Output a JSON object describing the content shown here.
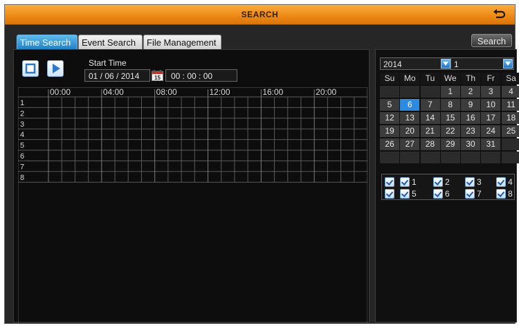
{
  "window": {
    "title": "SEARCH"
  },
  "tabs": [
    {
      "label": "Time Search",
      "active": true
    },
    {
      "label": "Event Search",
      "active": false
    },
    {
      "label": "File Management",
      "active": false
    }
  ],
  "search_button": "Search",
  "playback": {
    "stop_icon": "stop-icon",
    "play_icon": "play-icon"
  },
  "start_time": {
    "label": "Start Time",
    "date": "01 / 06 / 2014",
    "calendar_icon_day": "15",
    "time": "00  :  00  :  00"
  },
  "timeline": {
    "hours": [
      "00:00",
      "04:00",
      "08:00",
      "12:00",
      "16:00",
      "20:00"
    ],
    "channels": [
      "1",
      "2",
      "3",
      "4",
      "5",
      "6",
      "7",
      "8"
    ]
  },
  "calendar": {
    "year": "2014",
    "month": "1",
    "weekdays": [
      "Su",
      "Mo",
      "Tu",
      "We",
      "Th",
      "Fr",
      "Sa"
    ],
    "first_weekday_index": 3,
    "days_in_month": 31,
    "selected_day": "6",
    "days": [
      "1",
      "2",
      "3",
      "4",
      "5",
      "6",
      "7",
      "8",
      "9",
      "10",
      "11",
      "12",
      "13",
      "14",
      "15",
      "16",
      "17",
      "18",
      "19",
      "20",
      "21",
      "22",
      "23",
      "24",
      "25",
      "26",
      "27",
      "28",
      "29",
      "30",
      "31"
    ]
  },
  "channel_checkboxes": {
    "all_checked": true,
    "channels": [
      {
        "label": "1",
        "checked": true
      },
      {
        "label": "2",
        "checked": true
      },
      {
        "label": "3",
        "checked": true
      },
      {
        "label": "4",
        "checked": true
      },
      {
        "label": "5",
        "checked": true
      },
      {
        "label": "6",
        "checked": true
      },
      {
        "label": "7",
        "checked": true
      },
      {
        "label": "8",
        "checked": true
      }
    ]
  },
  "colors": {
    "titlebar": "#ee8a16",
    "active_tab": "#2c8be0",
    "selected_day": "#2c8be0",
    "panel_bg": "#0d0d0d"
  }
}
